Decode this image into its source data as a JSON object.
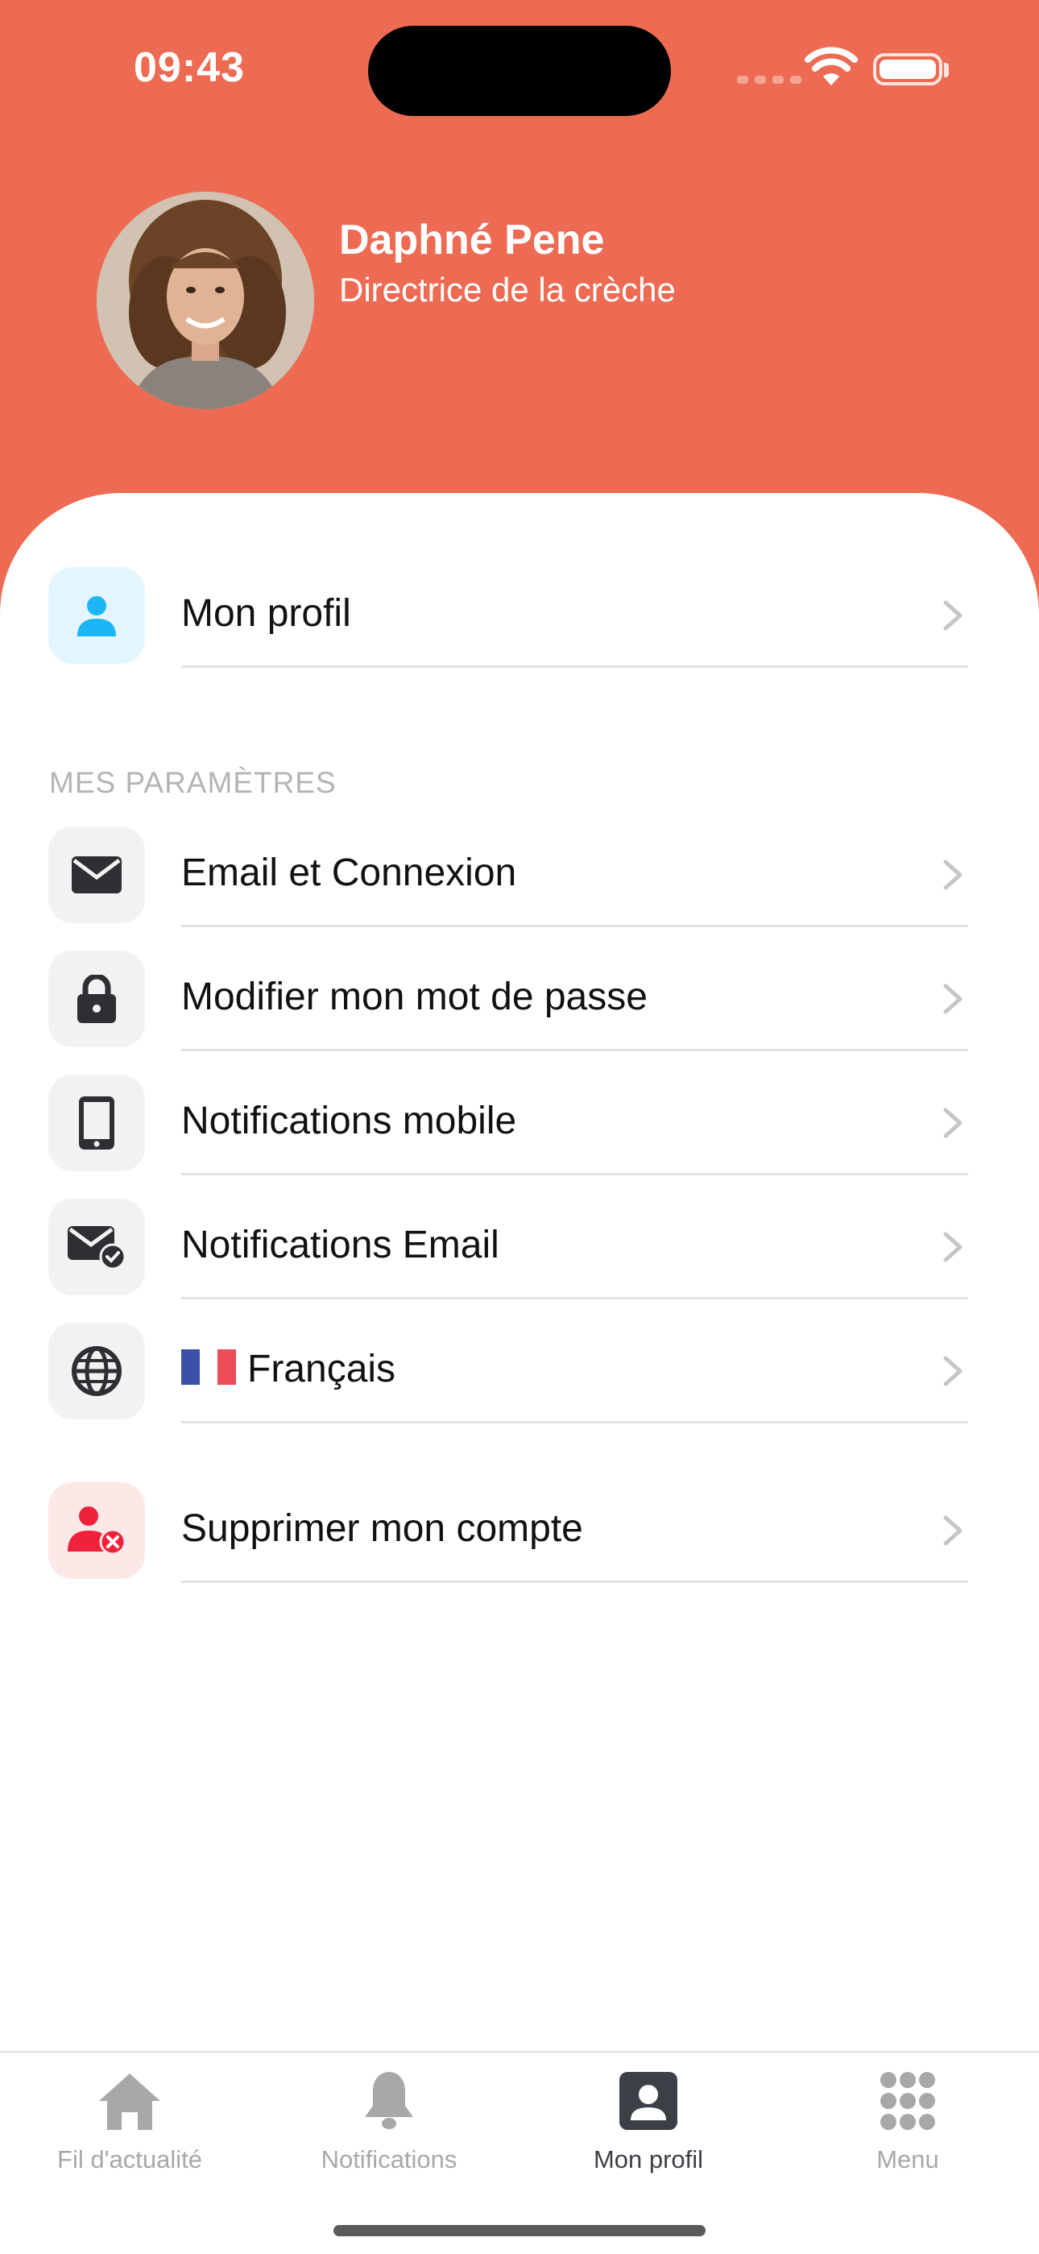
{
  "status_bar": {
    "time": "09:43"
  },
  "profile": {
    "name": "Daphné Pene",
    "role": "Directrice de la crèche"
  },
  "menu": {
    "profile_item": {
      "label": "Mon profil",
      "icon": "person-icon"
    },
    "section_title": "MES PARAMÈTRES",
    "items": [
      {
        "label": "Email et Connexion",
        "icon": "envelope-icon"
      },
      {
        "label": "Modifier mon mot de passe",
        "icon": "lock-icon"
      },
      {
        "label": "Notifications mobile",
        "icon": "mobile-phone-icon"
      },
      {
        "label": "Notifications Email",
        "icon": "envelope-check-icon"
      },
      {
        "label": "Français",
        "icon": "globe-icon",
        "flag": "france-flag"
      }
    ],
    "delete_item": {
      "label": "Supprimer mon compte",
      "icon": "user-remove-icon"
    }
  },
  "tabbar": {
    "tabs": [
      {
        "label": "Fil d'actualité",
        "icon": "home-icon",
        "active": false
      },
      {
        "label": "Notifications",
        "icon": "bell-icon",
        "active": false
      },
      {
        "label": "Mon profil",
        "icon": "profile-card-icon",
        "active": true
      },
      {
        "label": "Menu",
        "icon": "grid-dots-icon",
        "active": false
      }
    ]
  },
  "colors": {
    "brand": "#ee6b53",
    "profile_icon_bg": "#e3f6ff",
    "profile_icon": "#1cb5f5",
    "delete_icon_bg": "#fde8e8",
    "delete_icon": "#f0213a",
    "tab_active": "#3b3f46",
    "tab_inactive": "#a8a8a8"
  }
}
